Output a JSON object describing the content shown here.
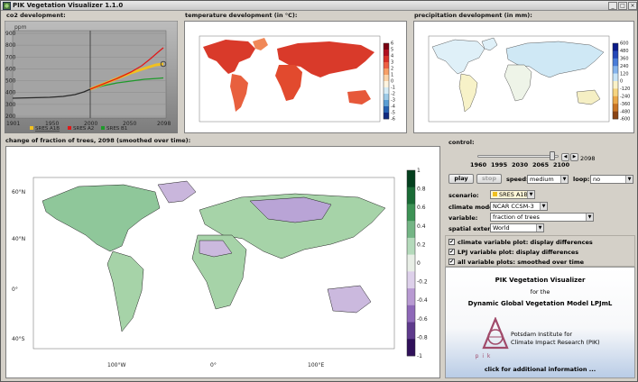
{
  "window": {
    "title": "PIK Vegetation Visualizer 1.1.0",
    "min": "_",
    "max": "□",
    "close": "×"
  },
  "co2": {
    "title": "co2 development:",
    "unit": "ppm",
    "y_ticks": [
      "900",
      "800",
      "700",
      "600",
      "500",
      "400",
      "300",
      "200"
    ],
    "x_ticks": [
      "1901",
      "1950",
      "2000",
      "2050",
      "2098"
    ],
    "legend": [
      {
        "name": "SRES A1B",
        "color": "#f0c020"
      },
      {
        "name": "SRES A2",
        "color": "#e01818"
      },
      {
        "name": "SRES B1",
        "color": "#1e9a2a"
      }
    ]
  },
  "temperature": {
    "title": "temperature development (in °C):",
    "colorbar_labels": [
      "6",
      "5",
      "4",
      "3",
      "2",
      "1",
      "0",
      "-1",
      "-2",
      "-3",
      "-4",
      "-5",
      "-6"
    ]
  },
  "precipitation": {
    "title": "precipitation development (in mm):",
    "colorbar_labels": [
      "600",
      "480",
      "360",
      "240",
      "120",
      "0",
      "-120",
      "-240",
      "-360",
      "-480",
      "-600"
    ]
  },
  "trees": {
    "title": "change of fraction of trees, 2098 (smoothed over time):",
    "lat_labels": [
      "60°N",
      "40°N",
      "0°",
      "40°S"
    ],
    "lon_labels": [
      "100°W",
      "0°",
      "100°E"
    ],
    "colorbar_labels": [
      "1",
      "0.8",
      "0.6",
      "0.4",
      "0.2",
      "0",
      "-0.2",
      "-0.4",
      "-0.6",
      "-0.8",
      "-1"
    ]
  },
  "control": {
    "title": "control:",
    "year_value": "2098",
    "slider_ticks": [
      "1960",
      "1995",
      "2030",
      "2065",
      "2100"
    ],
    "slider_value": 0.955,
    "play": "play",
    "stop": "stop",
    "speed_label": "speed:",
    "speed_value": "medium",
    "loop_label": "loop:",
    "loop_value": "no",
    "scenario_label": "scenario:",
    "scenario_value": "SRES A1B",
    "model_label": "climate model:",
    "model_value": "NCAR CCSM-3",
    "variable_label": "variable:",
    "variable_value": "fraction of trees",
    "extent_label": "spatial extent:",
    "extent_value": "World",
    "checks": [
      "climate variable plot: display differences",
      "LPJ variable plot: display differences",
      "all variable plots: smoothed over time"
    ]
  },
  "info": {
    "title": "PIK Vegetation Visualizer",
    "for": "for the",
    "model": "Dynamic Global Vegetation Model LPJmL",
    "institute1": "Potsdam Institute for",
    "institute2": "Climate Impact Research (PIK)",
    "logo_text": "p i k",
    "more": "click for additional information ..."
  }
}
